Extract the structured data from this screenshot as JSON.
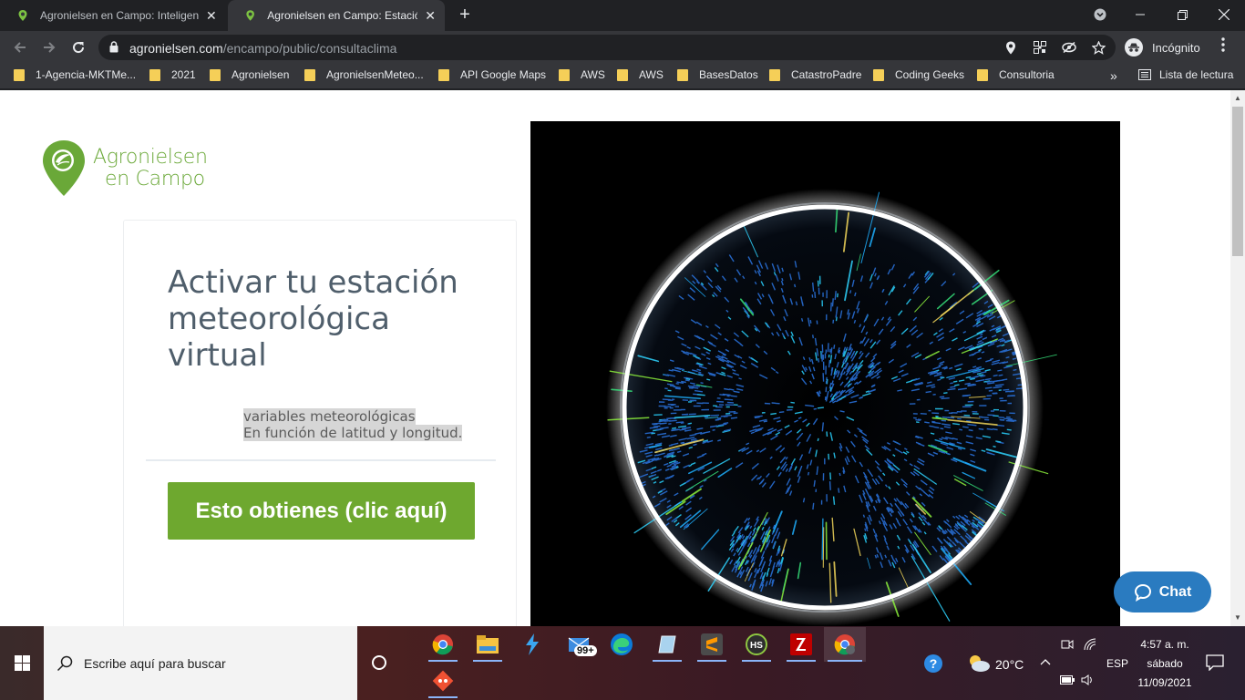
{
  "browser": {
    "tabs": [
      {
        "title": "Agronielsen en Campo: Inteligencia",
        "active": false
      },
      {
        "title": "Agronielsen en Campo: Estación meteorológica",
        "active": true
      }
    ],
    "new_tab": "+",
    "url_host": "agronielsen.com",
    "url_path": "/encampo/public/consultaclima",
    "incognito_label": "Incógnito",
    "bookmarks": [
      "1-Agencia-MKTMe...",
      "2021",
      "Agronielsen",
      "AgronielsenMeteo...",
      "API Google Maps",
      "AWS",
      "AWS",
      "BasesDatos",
      "CatastroPadre",
      "Coding Geeks",
      "Consultoria"
    ],
    "overflow": "»",
    "reading_list": "Lista de lectura"
  },
  "page": {
    "logo_line1": "Agronielsen",
    "logo_line2": "en Campo",
    "heading": "Activar tu estación meteorológica virtual",
    "highlight_line1": "variables meteorológicas",
    "highlight_line2": "En función de latitud y longitud.",
    "cta_label": "Esto obtienes (clic aquí)",
    "chat_label": "Chat"
  },
  "taskbar": {
    "search_placeholder": "Escribe aquí para buscar",
    "mail_badge": "99+",
    "weather_temp": "20°C",
    "language": "ESP",
    "time": "4:57 a. m.",
    "day": "sábado",
    "date": "11/09/2021"
  },
  "colors": {
    "brand_green": "#6aa838",
    "cta_green": "#6ea82f",
    "chat_blue": "#2a7bc0",
    "heading_slate": "#4f5e6b"
  }
}
